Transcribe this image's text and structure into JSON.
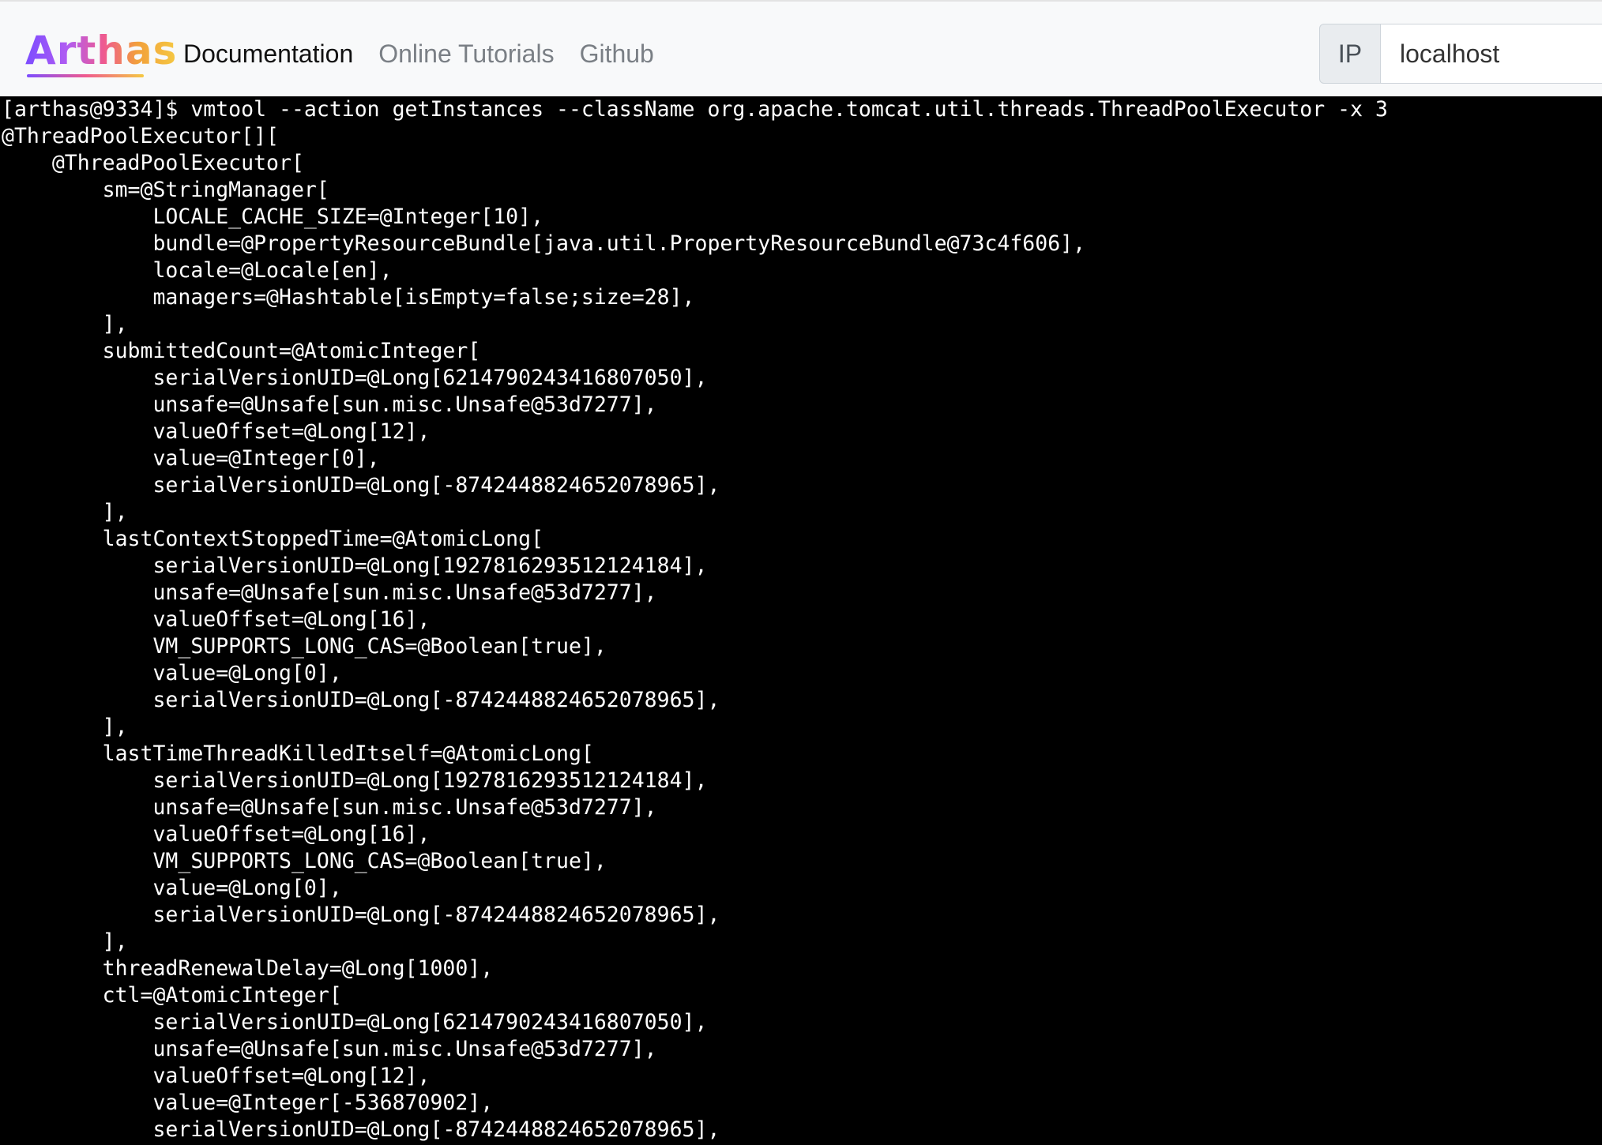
{
  "navbar": {
    "brand": "Arthas",
    "links": [
      {
        "label": "Documentation",
        "active": true
      },
      {
        "label": "Online Tutorials",
        "active": false
      },
      {
        "label": "Github",
        "active": false
      }
    ],
    "ip_label": "IP",
    "ip_value": "localhost"
  },
  "terminal": {
    "lines": [
      "[arthas@9334]$ vmtool --action getInstances --className org.apache.tomcat.util.threads.ThreadPoolExecutor -x 3",
      "@ThreadPoolExecutor[][",
      "    @ThreadPoolExecutor[",
      "        sm=@StringManager[",
      "            LOCALE_CACHE_SIZE=@Integer[10],",
      "            bundle=@PropertyResourceBundle[java.util.PropertyResourceBundle@73c4f606],",
      "            locale=@Locale[en],",
      "            managers=@Hashtable[isEmpty=false;size=28],",
      "        ],",
      "        submittedCount=@AtomicInteger[",
      "            serialVersionUID=@Long[6214790243416807050],",
      "            unsafe=@Unsafe[sun.misc.Unsafe@53d7277],",
      "            valueOffset=@Long[12],",
      "            value=@Integer[0],",
      "            serialVersionUID=@Long[-8742448824652078965],",
      "        ],",
      "        lastContextStoppedTime=@AtomicLong[",
      "            serialVersionUID=@Long[1927816293512124184],",
      "            unsafe=@Unsafe[sun.misc.Unsafe@53d7277],",
      "            valueOffset=@Long[16],",
      "            VM_SUPPORTS_LONG_CAS=@Boolean[true],",
      "            value=@Long[0],",
      "            serialVersionUID=@Long[-8742448824652078965],",
      "        ],",
      "        lastTimeThreadKilledItself=@AtomicLong[",
      "            serialVersionUID=@Long[1927816293512124184],",
      "            unsafe=@Unsafe[sun.misc.Unsafe@53d7277],",
      "            valueOffset=@Long[16],",
      "            VM_SUPPORTS_LONG_CAS=@Boolean[true],",
      "            value=@Long[0],",
      "            serialVersionUID=@Long[-8742448824652078965],",
      "        ],",
      "        threadRenewalDelay=@Long[1000],",
      "        ctl=@AtomicInteger[",
      "            serialVersionUID=@Long[6214790243416807050],",
      "            unsafe=@Unsafe[sun.misc.Unsafe@53d7277],",
      "            valueOffset=@Long[12],",
      "            value=@Integer[-536870902],",
      "            serialVersionUID=@Long[-8742448824652078965],"
    ]
  }
}
